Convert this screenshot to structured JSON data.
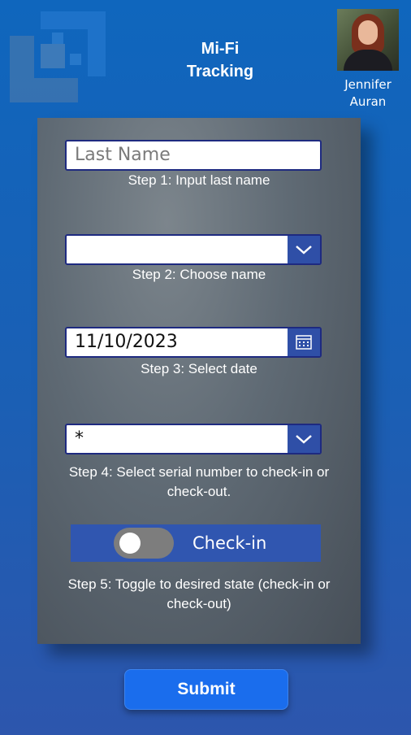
{
  "app": {
    "title_line1": "Mi-Fi",
    "title_line2": "Tracking"
  },
  "user": {
    "first_name": "Jennifer",
    "last_name": "Auran"
  },
  "form": {
    "last_name": {
      "value": "",
      "placeholder": "Last Name",
      "step_label": "Step 1:  Input last name"
    },
    "name_select": {
      "value": "",
      "step_label": "Step 2:  Choose name",
      "icon": "chevron-down-icon"
    },
    "date": {
      "value": "11/10/2023",
      "step_label": "Step 3:  Select date",
      "icon": "calendar-icon"
    },
    "serial_select": {
      "value": "*",
      "step_label_line1": "Step 4:  Select serial number to check-in or",
      "step_label_line2": "check-out.",
      "icon": "chevron-down-icon"
    },
    "toggle": {
      "label": "Check-in",
      "checked": false,
      "step_label_line1": "Step 5:  Toggle to desired state (check-in or",
      "step_label_line2": "check-out)"
    }
  },
  "submit": {
    "label": "Submit"
  },
  "colors": {
    "background": "#1b5fb4",
    "accent": "#2f4fa7",
    "submit": "#1a6ded",
    "panel": "#5f6a74"
  }
}
